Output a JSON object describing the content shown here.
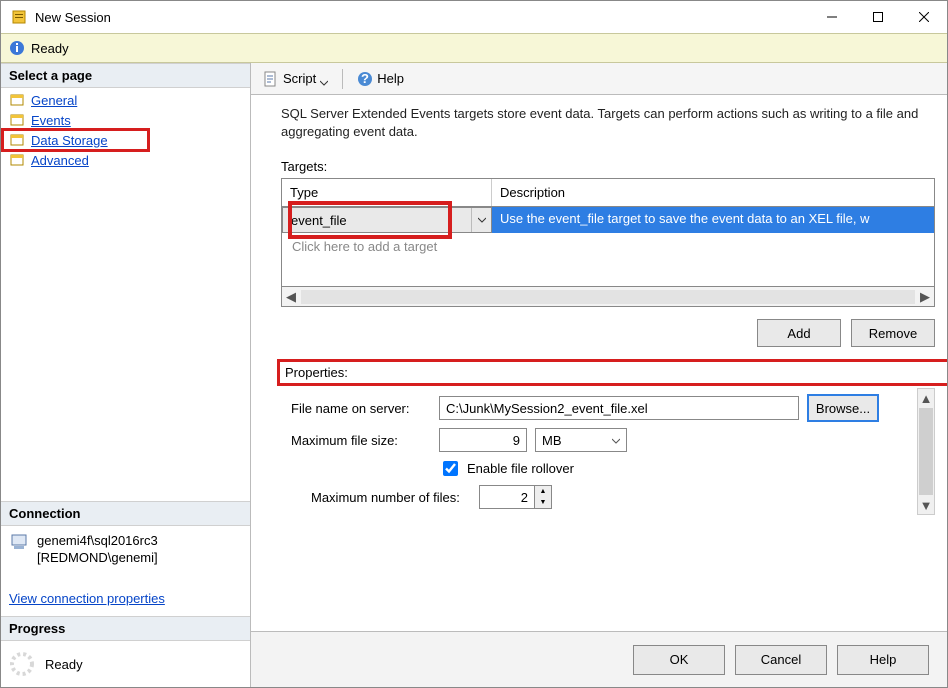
{
  "window": {
    "title": "New Session"
  },
  "status": {
    "text": "Ready"
  },
  "left": {
    "select_page": "Select a page",
    "pages": {
      "general": "General",
      "events": "Events",
      "data_storage": "Data Storage",
      "advanced": "Advanced"
    },
    "connection_header": "Connection",
    "connection_server": "genemi4f\\sql2016rc3",
    "connection_user": "[REDMOND\\genemi]",
    "view_props": "View connection properties",
    "progress_header": "Progress",
    "progress_text": "Ready"
  },
  "toolbar": {
    "script": "Script",
    "help": "Help"
  },
  "main": {
    "intro": "SQL Server Extended Events targets store event data. Targets can perform actions such as writing to a file and aggregating event data.",
    "targets_label": "Targets:",
    "col_type": "Type",
    "col_desc": "Description",
    "target_type": "event_file",
    "target_desc": "Use the event_file target to save the event data to an XEL file, w",
    "add_target_placeholder": "Click here to add a target",
    "btn_add": "Add",
    "btn_remove": "Remove",
    "properties_label": "Properties:",
    "file_name_label": "File name on server:",
    "file_name_value": "C:\\Junk\\MySession2_event_file.xel",
    "browse": "Browse...",
    "max_size_label": "Maximum file size:",
    "max_size_value": "9",
    "max_size_unit": "MB",
    "enable_rollover": "Enable file rollover",
    "max_files_label": "Maximum number of files:",
    "max_files_value": "2"
  },
  "footer": {
    "ok": "OK",
    "cancel": "Cancel",
    "help": "Help"
  }
}
